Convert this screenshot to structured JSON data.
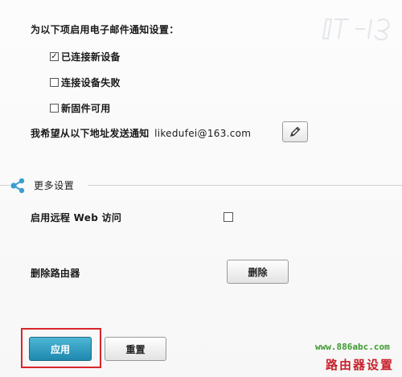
{
  "notifications": {
    "title": "为以下项启用电子邮件通知设置：",
    "options": [
      {
        "label": "已连接新设备",
        "checked": true
      },
      {
        "label": "连接设备失败",
        "checked": false
      },
      {
        "label": "新固件可用",
        "checked": false
      }
    ],
    "send_to_label": "我希望从以下地址发送通知",
    "email": "likedufei@163.com",
    "edit_icon": "pencil-icon"
  },
  "more_settings": {
    "title": "更多设置",
    "icon": "share-icon",
    "remote_web_access": {
      "label": "启用远程 Web 访问",
      "checked": false
    },
    "delete_router": {
      "label": "删除路由器",
      "button_label": "删除"
    }
  },
  "actions": {
    "apply_label": "应用",
    "reset_label": "重置",
    "highlight_color": "#d9262b",
    "apply_color": "#1f88ae"
  },
  "watermark": {
    "url": "www.886abc.com",
    "caption": "路由器设置",
    "url_color": "#3c9a2e",
    "caption_color": "#c8202a"
  }
}
